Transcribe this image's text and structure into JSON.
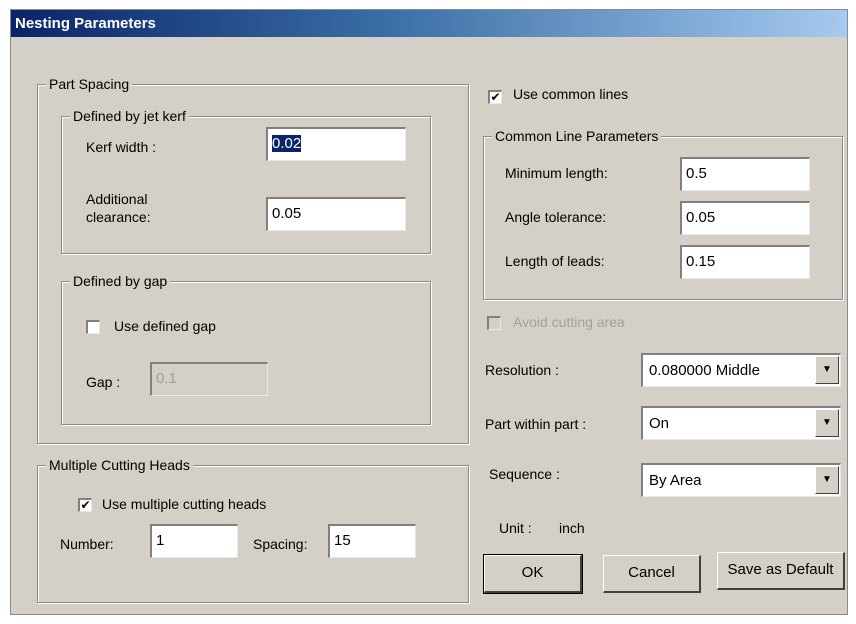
{
  "window": {
    "title": "Nesting Parameters",
    "close_glyph": "×"
  },
  "part_spacing": {
    "legend": "Part Spacing",
    "kerf_group": {
      "legend": "Defined by jet kerf",
      "kerf_width_label": "Kerf width :",
      "kerf_width_value": "0.02",
      "additional_label_line1": "Additional",
      "additional_label_line2": "clearance:",
      "additional_value": "0.05"
    },
    "gap_group": {
      "legend": "Defined by gap",
      "use_defined_gap_label": "Use defined gap",
      "use_defined_gap_checked": false,
      "gap_label": "Gap :",
      "gap_value": "0.1"
    }
  },
  "multiple_heads": {
    "legend": "Multiple Cutting Heads",
    "use_multiple_label": "Use multiple cutting heads",
    "use_multiple_checked": true,
    "number_label": "Number:",
    "number_value": "1",
    "spacing_label": "Spacing:",
    "spacing_value": "15"
  },
  "common_lines": {
    "use_label": "Use common lines",
    "use_checked": true,
    "legend": "Common Line Parameters",
    "min_length_label": "Minimum length:",
    "min_length_value": "0.5",
    "angle_tol_label": "Angle tolerance:",
    "angle_tol_value": "0.05",
    "lead_length_label": "Length of leads:",
    "lead_length_value": "0.15"
  },
  "avoid_cutting": {
    "label": "Avoid cutting area",
    "checked": false,
    "enabled": false
  },
  "resolution": {
    "label": "Resolution :",
    "value": "0.080000 Middle"
  },
  "part_within_part": {
    "label": "Part within part :",
    "value": "On"
  },
  "sequence": {
    "label": "Sequence :",
    "value": "By Area"
  },
  "unit": {
    "label": "Unit :",
    "value": "inch"
  },
  "buttons": {
    "ok": "OK",
    "cancel": "Cancel",
    "save_default": "Save as Default"
  },
  "icons": {
    "check": "✔",
    "dropdown": "▼"
  }
}
